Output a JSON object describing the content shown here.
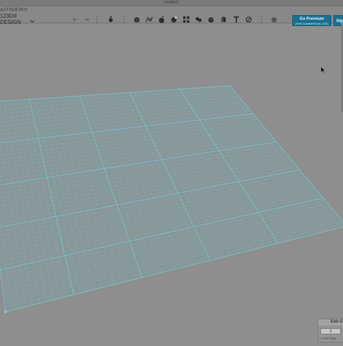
{
  "window": {
    "title": "Untitled*"
  },
  "brand": {
    "line1": "AUTODESK®",
    "line2": "123D® DESIGN"
  },
  "toolbar": {
    "undo_icon": "undo-icon",
    "redo_icon": "redo-icon",
    "tools": [
      "transform-icon",
      "sketch-icon",
      "construct-icon",
      "modify-icon",
      "pattern-icon",
      "grouping-icon",
      "combine-icon",
      "measure-icon",
      "text-icon",
      "snap-icon",
      "material-icon"
    ]
  },
  "premium": {
    "label": "Go Premium",
    "sub": "(FOR COMMERCIAL USE)"
  },
  "signin": {
    "label": "Sign In"
  },
  "edit_grid": {
    "title": "Edit Grid",
    "value": "1",
    "unit": "Linear Snap"
  },
  "colors": {
    "grid": "#6ecfe0",
    "premium": "#1a6f8f",
    "background": "#8e8e8e"
  }
}
